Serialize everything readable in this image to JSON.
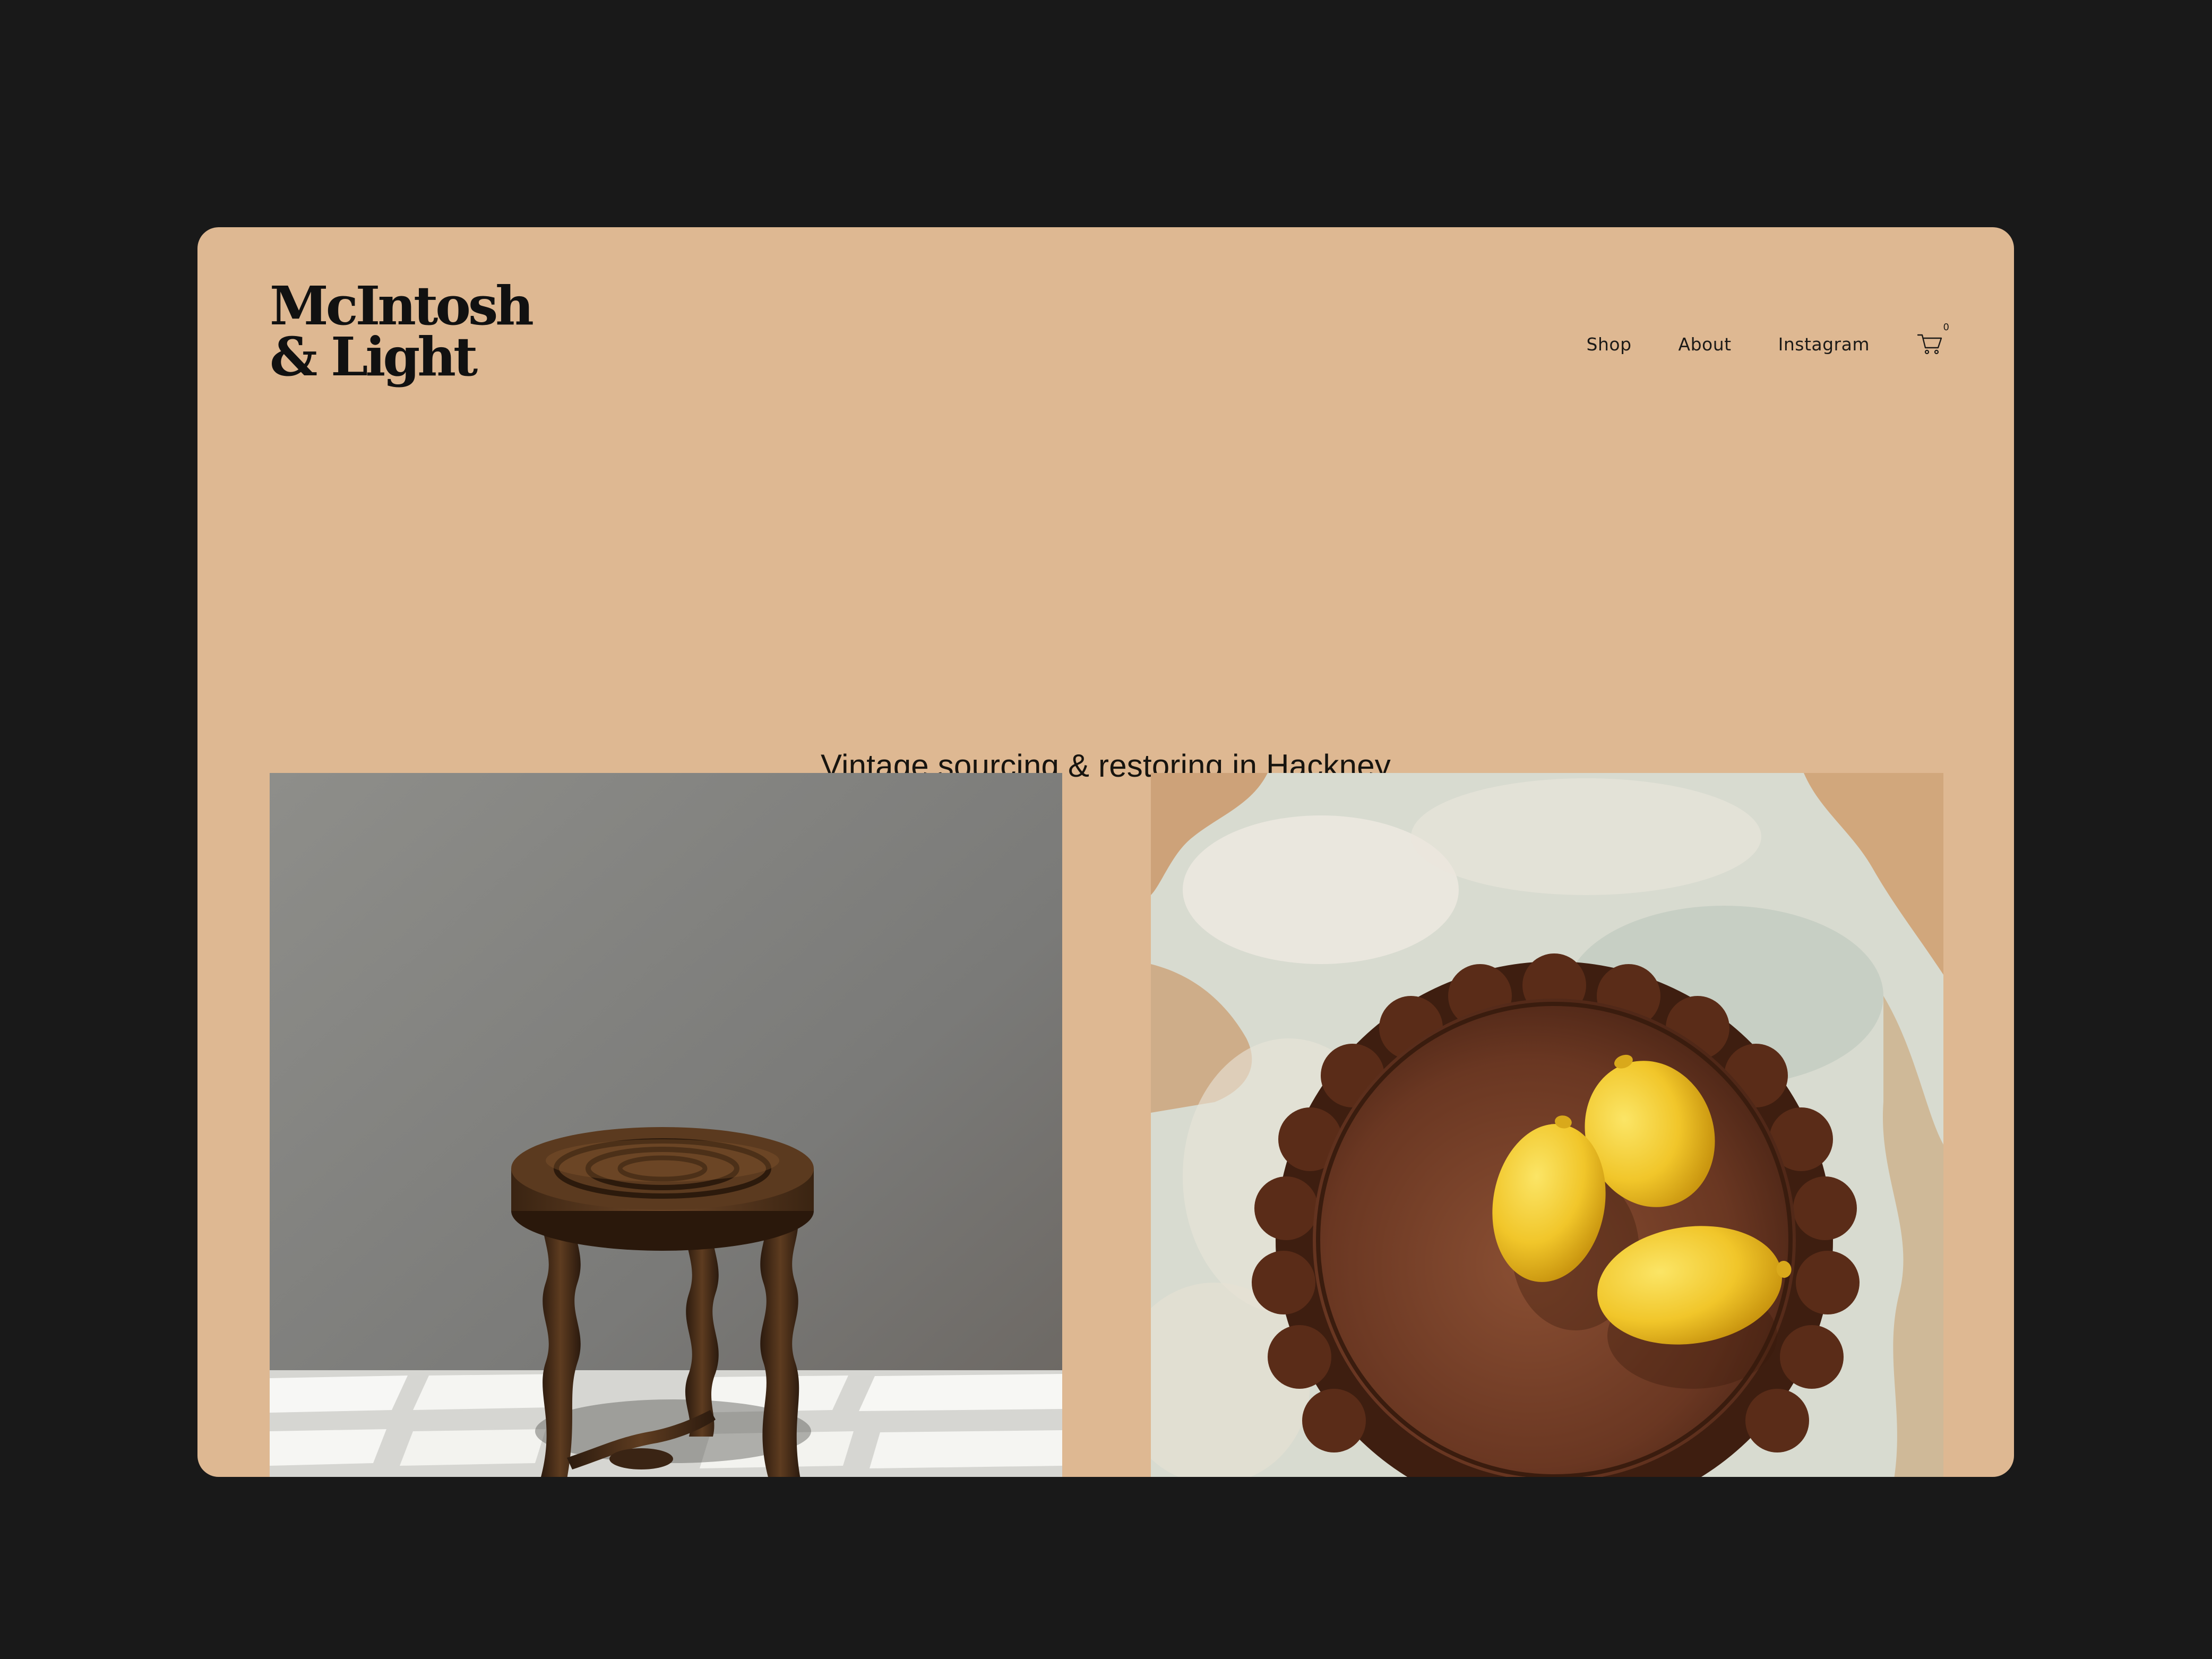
{
  "brand": {
    "line1": "McIntosh",
    "line2": "& Light"
  },
  "nav": {
    "items": [
      {
        "label": "Shop"
      },
      {
        "label": "About"
      },
      {
        "label": "Instagram"
      }
    ],
    "cart_count": "0"
  },
  "hero": {
    "tagline": "Vintage sourcing & restoring in Hackney"
  },
  "gallery": [
    {
      "subject": "Vintage wooden stool with bobbin legs"
    },
    {
      "subject": "Three lemons on a scalloped copper tray on onyx"
    }
  ],
  "colors": {
    "page_background": "#191919",
    "panel": "#deb892",
    "text": "#111111"
  },
  "icons": [
    "cart-icon"
  ]
}
